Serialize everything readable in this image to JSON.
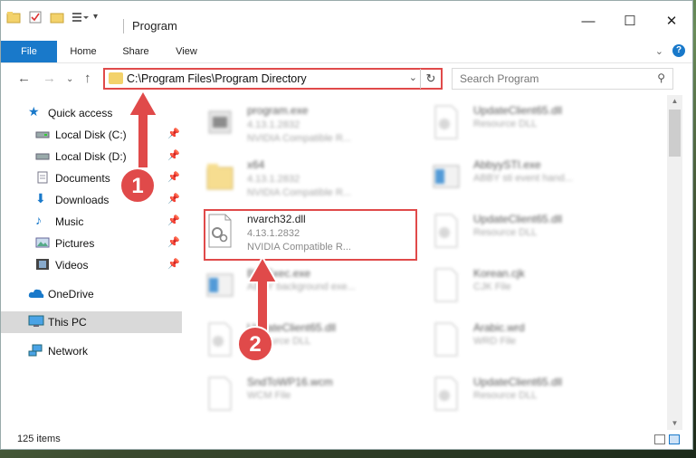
{
  "window": {
    "title": "Program",
    "controls": {
      "minimize": "—",
      "maximize": "☐",
      "close": "✕"
    }
  },
  "ribbon": {
    "tabs": [
      "File",
      "Home",
      "Share",
      "View"
    ]
  },
  "address_bar": {
    "path": "C:\\Program Files\\Program Directory",
    "highlight_color": "#e04a4a"
  },
  "search": {
    "placeholder": "Search Program"
  },
  "sidebar": {
    "items": [
      {
        "label": "Quick access",
        "icon": "star-icon"
      },
      {
        "label": "Local Disk (C:)",
        "icon": "drive-icon",
        "pinned": true
      },
      {
        "label": "Local Disk (D:)",
        "icon": "drive-icon",
        "pinned": true
      },
      {
        "label": "Documents",
        "icon": "documents-icon",
        "pinned": true
      },
      {
        "label": "Downloads",
        "icon": "download-icon",
        "pinned": true
      },
      {
        "label": "Music",
        "icon": "music-icon",
        "pinned": true
      },
      {
        "label": "Pictures",
        "icon": "pictures-icon",
        "pinned": true
      },
      {
        "label": "Videos",
        "icon": "videos-icon",
        "pinned": true
      },
      {
        "label": "OneDrive",
        "icon": "cloud-icon"
      },
      {
        "label": "This PC",
        "icon": "computer-icon",
        "selected": true
      },
      {
        "label": "Network",
        "icon": "network-icon"
      }
    ]
  },
  "files": [
    {
      "name": "program.exe",
      "version": "4.13.1.2832",
      "desc": "NVIDIA Compatible R..."
    },
    {
      "name": "UpdateClient65.dll",
      "version": "",
      "desc": "Resource DLL"
    },
    {
      "name": "x64",
      "version": "4.13.1.2832",
      "desc": "NVIDIA Compatible R..."
    },
    {
      "name": "AbbyySTI.exe",
      "version": "",
      "desc": "ABBY sti event hand..."
    },
    {
      "name": "nvarch32.dll",
      "version": "4.13.1.2832",
      "desc": "NVIDIA Compatible R...",
      "highlighted": true
    },
    {
      "name": "UpdateClient65.dll",
      "version": "",
      "desc": "Resource DLL"
    },
    {
      "name": "BkgExec.exe",
      "version": "",
      "desc": "ABBY background exe..."
    },
    {
      "name": "Korean.cjk",
      "version": "",
      "desc": "CJK File"
    },
    {
      "name": "UpdateClient65.dll",
      "version": "",
      "desc": "Resource DLL"
    },
    {
      "name": "Arabic.wrd",
      "version": "",
      "desc": "WRD File"
    },
    {
      "name": "SndToWP16.wcm",
      "version": "",
      "desc": "WCM File"
    },
    {
      "name": "UpdateClient65.dll",
      "version": "",
      "desc": "Resource DLL"
    }
  ],
  "status": {
    "item_count": "125 items"
  },
  "callouts": {
    "step1": "1",
    "step2": "2"
  }
}
